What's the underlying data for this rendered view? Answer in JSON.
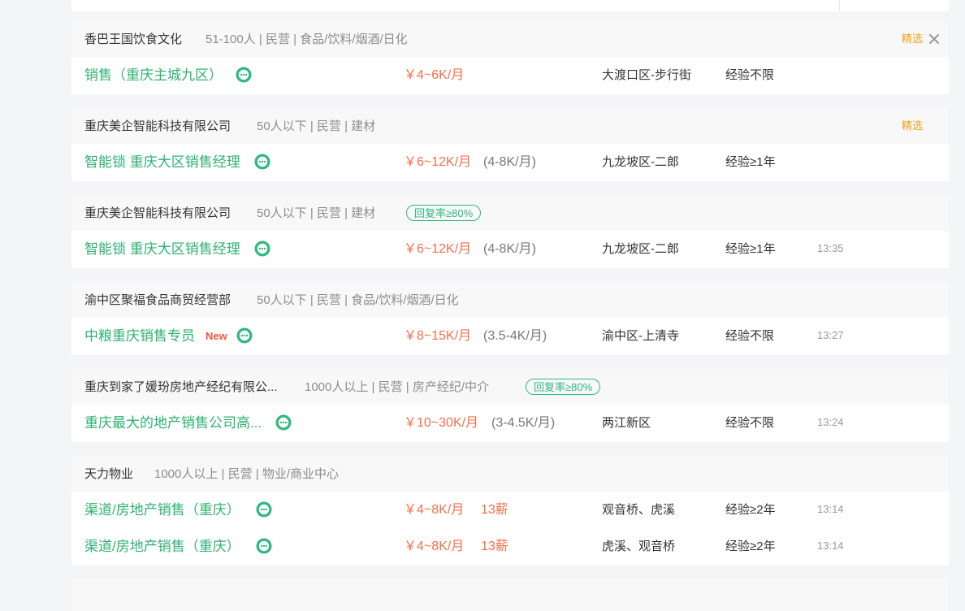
{
  "listings": [
    {
      "company": "香巴王国饮食文化",
      "meta": "51-100人 | 民营 | 食品/饮料/烟酒/日化",
      "featured": "精选",
      "jobs": [
        {
          "title": "销售（重庆主城九区）",
          "salary": "￥4~6K/月",
          "location": "大渡口区-步行街",
          "experience": "经验不限"
        }
      ]
    },
    {
      "company": "重庆美企智能科技有限公司",
      "meta": "50人以下 | 民营 | 建材",
      "featured": "精选",
      "jobs": [
        {
          "title": "智能锁 重庆大区销售经理",
          "salary": "￥6~12K/月",
          "salary_extra": "(4-8K/月)",
          "location": "九龙坡区-二郎",
          "experience": "经验≥1年"
        }
      ]
    },
    {
      "company": "重庆美企智能科技有限公司",
      "meta": "50人以下 | 民营 | 建材",
      "reply_badge": "回复率≥80%",
      "jobs": [
        {
          "title": "智能锁 重庆大区销售经理",
          "salary": "￥6~12K/月",
          "salary_extra": "(4-8K/月)",
          "location": "九龙坡区-二郎",
          "experience": "经验≥1年",
          "time": "13:35"
        }
      ]
    },
    {
      "company": "渝中区聚福食品商贸经营部",
      "meta": "50人以下 | 民营 | 食品/饮料/烟酒/日化",
      "jobs": [
        {
          "title": "中粮重庆销售专员",
          "new_tag": "New",
          "salary": "￥8~15K/月",
          "salary_extra": "(3.5-4K/月)",
          "location": "渝中区-上清寺",
          "experience": "经验不限",
          "time": "13:27"
        }
      ]
    },
    {
      "company": "重庆到家了媛玢房地产经纪有限公...",
      "meta": "1000人以上 | 民营 | 房产经纪/中介",
      "reply_badge": "回复率≥80%",
      "jobs": [
        {
          "title": "重庆最大的地产销售公司高...",
          "salary": "￥10~30K/月",
          "salary_extra": "(3-4.5K/月)",
          "location": "两江新区",
          "experience": "经验不限",
          "time": "13:24"
        }
      ]
    },
    {
      "company": "天力物业",
      "meta": "1000人以上 | 民营 | 物业/商业中心",
      "jobs": [
        {
          "title": "渠道/房地产销售（重庆）",
          "salary": "￥4~8K/月",
          "salary_months": "13薪",
          "location": "观音桥、虎溪",
          "experience": "经验≥2年",
          "time": "13:14"
        },
        {
          "title": "渠道/房地产销售（重庆）",
          "salary": "￥4~8K/月",
          "salary_months": "13薪",
          "location": "虎溪、观音桥",
          "experience": "经验≥2年",
          "time": "13:14"
        }
      ]
    }
  ],
  "colors": {
    "job_title": "#2fb173",
    "salary": "#f46f4c",
    "featured": "#f0a21a",
    "badge": "#2fb880"
  },
  "icons": {
    "chat": "chat-bubble-icon",
    "close": "close-icon"
  }
}
